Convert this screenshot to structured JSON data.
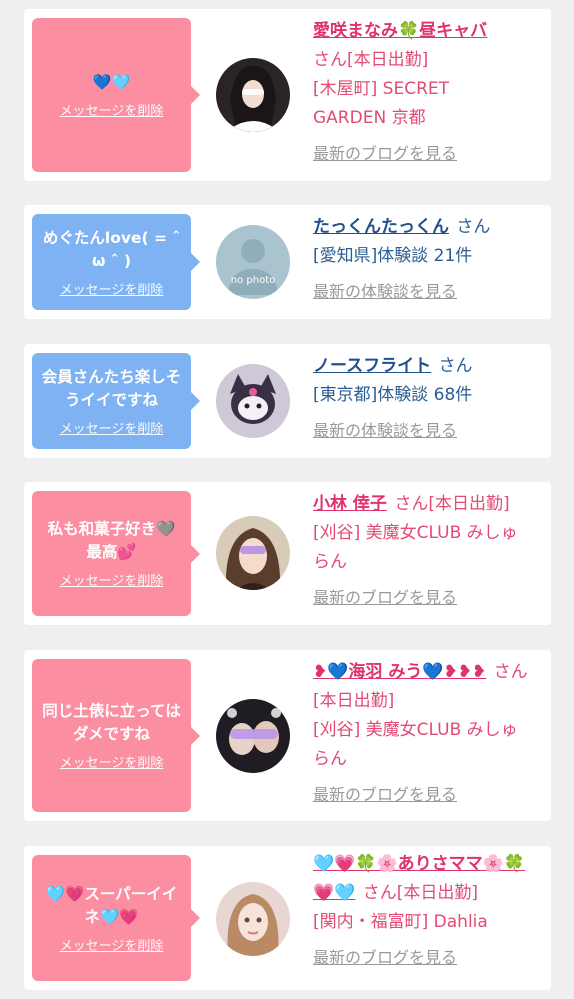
{
  "delete_label": "メッセージを削除",
  "cards": [
    {
      "message": "💙🩵",
      "name": "愛咲まなみ🍀昼キャバ",
      "suffix": "さん[本日出勤]",
      "details": [
        "[木屋町] SECRET",
        "GARDEN 京都"
      ],
      "link": "最新のブログを見る"
    },
    {
      "message": "めぐたんlove( = ˆ ω ˆ )",
      "name": "たっくんたっくん",
      "suffix": "さん",
      "details": [
        "[愛知県]体験談 21件"
      ],
      "link": "最新の体験談を見る"
    },
    {
      "message": "会員さんたち楽しそうイイですね",
      "name": "ノースフライト",
      "suffix": "さん",
      "details": [
        "[東京都]体験談 68件"
      ],
      "link": "最新の体験談を見る"
    },
    {
      "message": "私も和菓子好き🩶最高💕",
      "name": "小林 倖子",
      "suffix": "さん[本日出勤]",
      "details": [
        "[刈谷] 美魔女CLUB みしゅ",
        "らん"
      ],
      "link": "最新のブログを見る"
    },
    {
      "message": "同じ土俵に立ってはダメですね",
      "name": "❥💙海羽 みう💙❥❥❥",
      "suffix": "さん[本日出勤]",
      "details": [
        "[刈谷] 美魔女CLUB みしゅ",
        "らん"
      ],
      "link": "最新のブログを見る"
    },
    {
      "message": "🩵💗スーパーイイネ🩵💗",
      "name": "🩵💗🍀🌸ありさママ🌸🍀💗🩵",
      "suffix": "さん[本日出勤]",
      "details": [
        "[関内・福富町] Dahlia"
      ],
      "link": "最新のブログを見る"
    }
  ],
  "avatar_labels": {
    "no_photo": "no photo"
  },
  "colors": {
    "pink_bubble": "#fc8ea2",
    "blue_bubble": "#7fb2f2",
    "cast_text": "#e34a74",
    "member_text": "#2d5d95"
  }
}
